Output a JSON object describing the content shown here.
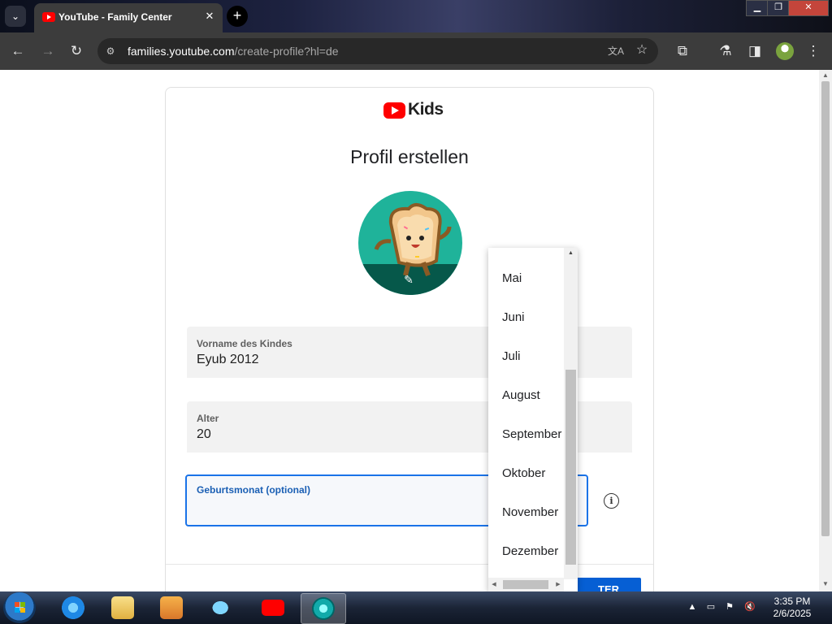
{
  "browser": {
    "tab": {
      "title": "YouTube - Family Center"
    },
    "omnibox": {
      "domain": "families.youtube.com",
      "path": "/create-profile?hl=de"
    }
  },
  "page": {
    "logo_text": "Kids",
    "heading": "Profil erstellen",
    "fields": {
      "name": {
        "label": "Vorname des Kindes",
        "value": "Eyub 2012"
      },
      "age": {
        "label": "Alter",
        "value": "20"
      },
      "birth_month": {
        "label": "Geburtsmonat (optional)",
        "value": ""
      }
    },
    "next_button_partial": "TER"
  },
  "dropdown": {
    "items": [
      "Mai",
      "Juni",
      "Juli",
      "August",
      "September",
      "Oktober",
      "November",
      "Dezember"
    ]
  },
  "taskbar": {
    "time": "3:35 PM",
    "date": "2/6/2025"
  },
  "colors": {
    "accent": "#1a73e8",
    "youtube_red": "#ff0000",
    "profile_bg": "#1fb39a"
  }
}
